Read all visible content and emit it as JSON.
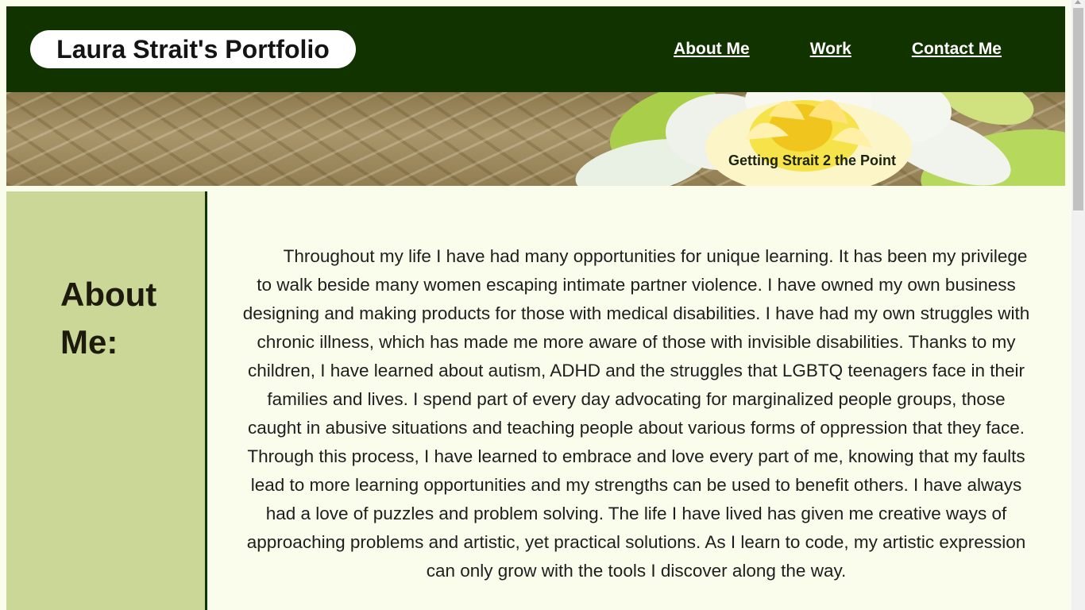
{
  "header": {
    "title": "Laura Strait's Portfolio",
    "nav": [
      "About Me",
      "Work",
      "Contact Me"
    ]
  },
  "banner": {
    "tagline": "Getting Strait 2 the Point",
    "image": "water-lily-on-water"
  },
  "sidebar": {
    "heading": "About Me:"
  },
  "main": {
    "about_text": "Throughout my life I have had many opportunities for unique learning. It has been my privilege to walk beside many women escaping intimate partner violence. I have owned my own business designing and making products for those with medical disabilities. I have had my own struggles with chronic illness, which has made me more aware of those with invisible disabilities. Thanks to my children, I have learned about autism, ADHD and the struggles that LGBTQ teenagers face in their families and lives. I spend part of every day advocating for marginalized people groups, those caught in abusive situations and teaching people about various forms of oppression that they face. Through this process, I have learned to embrace and love every part of me, knowing that my faults lead to more learning opportunities and my strengths can be used to benefit others. I have always had a love of puzzles and problem solving. The life I have lived has given me creative ways of approaching problems and artistic, yet practical solutions. As I learn to code, my artistic expression can only grow with the tools I discover along the way."
  },
  "colors": {
    "header_bg": "#113300",
    "sidebar_bg": "#cbd797",
    "page_bg": "#fafcec",
    "text": "#1e1e1e"
  }
}
